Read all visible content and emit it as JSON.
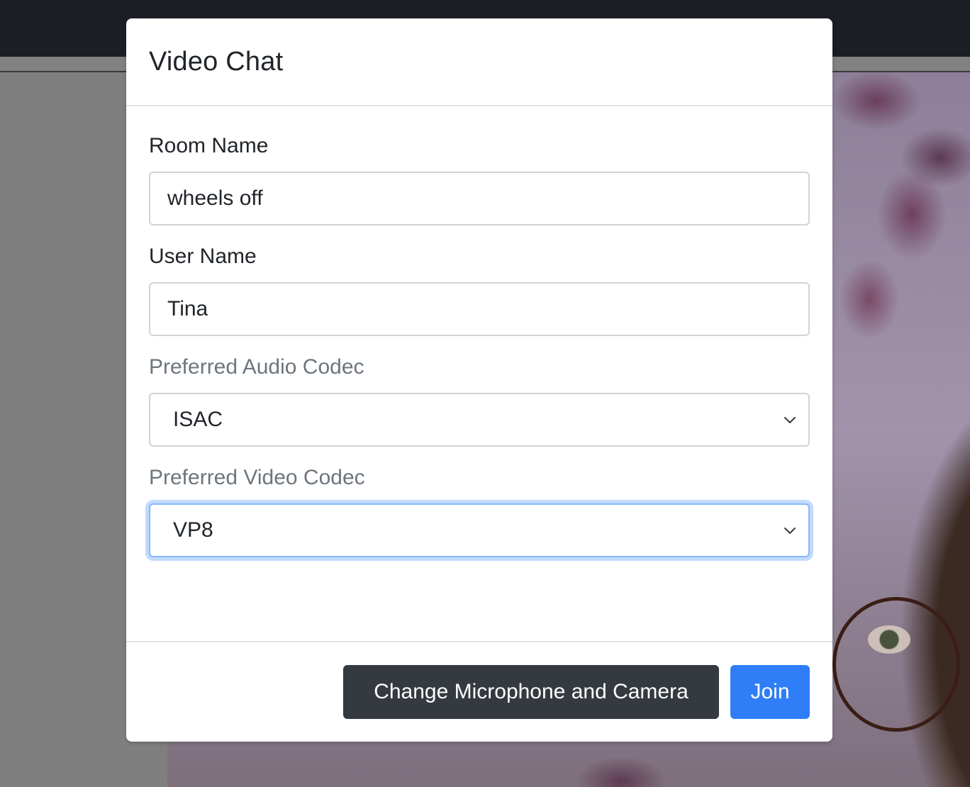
{
  "modal": {
    "title": "Video Chat",
    "room_name": {
      "label": "Room Name",
      "value": "wheels off"
    },
    "user_name": {
      "label": "User Name",
      "value": "Tina"
    },
    "audio_codec": {
      "label": "Preferred Audio Codec",
      "selected": "ISAC"
    },
    "video_codec": {
      "label": "Preferred Video Codec",
      "selected": "VP8"
    },
    "buttons": {
      "change_devices": "Change Microphone and Camera",
      "join": "Join"
    }
  },
  "colors": {
    "primary": "#2f7ef7",
    "dark": "#343a40",
    "navbar": "#1b1f24",
    "focus_ring": "#86b7fe"
  },
  "icons": {
    "select_arrow": "chevron-down-icon"
  }
}
